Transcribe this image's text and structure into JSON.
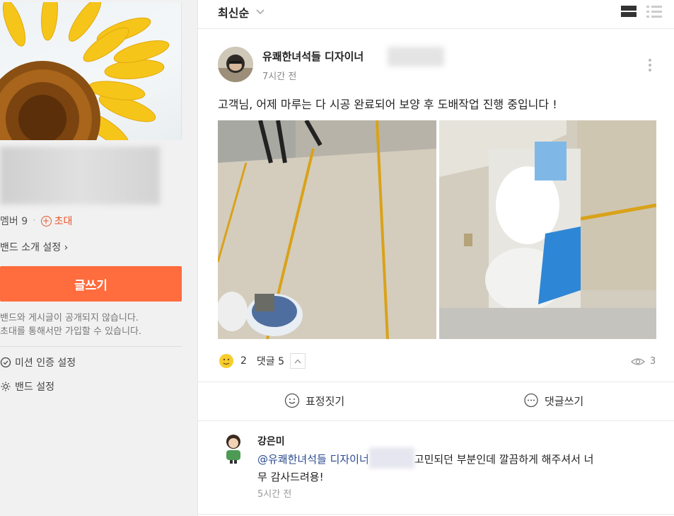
{
  "sidebar": {
    "members_label": "멤버 9",
    "invite_label": "초대",
    "band_intro_label": "밴드 소개 설정",
    "write_button": "글쓰기",
    "privacy_line1": "밴드와 게시글이 공개되지 않습니다.",
    "privacy_line2": "초대를 통해서만 가입할 수 있습니다.",
    "mission_label": "미션 인증 설정",
    "settings_label": "밴드 설정"
  },
  "sort": {
    "label": "최신순"
  },
  "post": {
    "author": "유쾌한녀석들 디자이너",
    "time": "7시간 전",
    "text": "고객님, 어제 마루는 다 시공 완료되어 보양 후 도배작업 진행 중입니다 !",
    "reaction_count": "2",
    "comment_label": "댓글 5",
    "view_count": "3",
    "emotion_button": "표정짓기",
    "comment_button": "댓글쓰기"
  },
  "comment": {
    "name": "강은미",
    "mention": "@유쾌한녀석들 디자이너",
    "text_line1": "고민되던 부분인데 깔끔하게 해주셔서 너",
    "text_line2": "무 감사드려용!",
    "time": "5시간 전"
  },
  "icons": {
    "invite": "plus-circle-icon",
    "chevron": "chevron-right-icon",
    "mission": "check-circle-icon",
    "settings": "gear-icon",
    "sort": "chevron-down-icon",
    "view_card": "card-view-icon",
    "view_list": "list-view-icon",
    "more": "more-vertical-icon",
    "reaction": "emoji-icon",
    "views": "eye-icon",
    "emotion": "smile-icon",
    "comment": "speech-bubble-icon"
  },
  "colors": {
    "accent": "#ff6c3e",
    "invite": "#e8542b",
    "mention": "#2b4a8f"
  }
}
